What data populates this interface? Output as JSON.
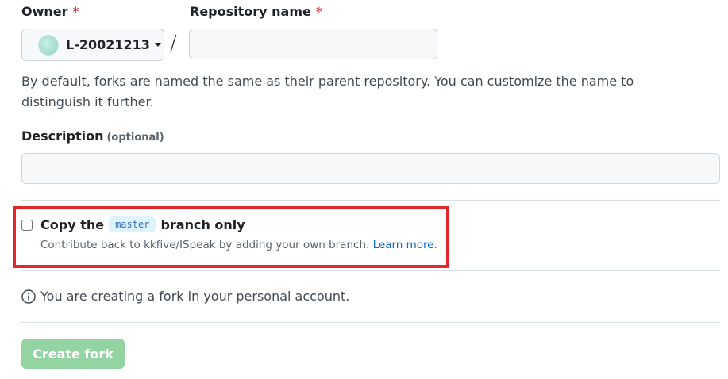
{
  "owner": {
    "label": "Owner",
    "required_mark": "*",
    "value": "L-20021213"
  },
  "repository": {
    "label": "Repository name",
    "required_mark": "*",
    "value": "",
    "separator": "/"
  },
  "help_text": "By default, forks are named the same as their parent repository. You can customize the name to distinguish it further.",
  "description": {
    "label": "Description",
    "optional_label": "(optional)",
    "value": ""
  },
  "copy_branch": {
    "checked": false,
    "prefix": "Copy the",
    "branch": "master",
    "suffix": "branch only",
    "sub_text": "Contribute back to kkfive/ISpeak by adding your own branch.",
    "learn_more": "Learn more",
    "period": "."
  },
  "info_text": "You are creating a fork in your personal account.",
  "create_button": "Create fork",
  "colors": {
    "highlight_border": "#e6262b",
    "create_button_bg": "#94d3a2",
    "link": "#0969da",
    "required": "#d1242f"
  },
  "icons": {
    "info": "info-icon",
    "caret": "chevron-down-icon"
  }
}
